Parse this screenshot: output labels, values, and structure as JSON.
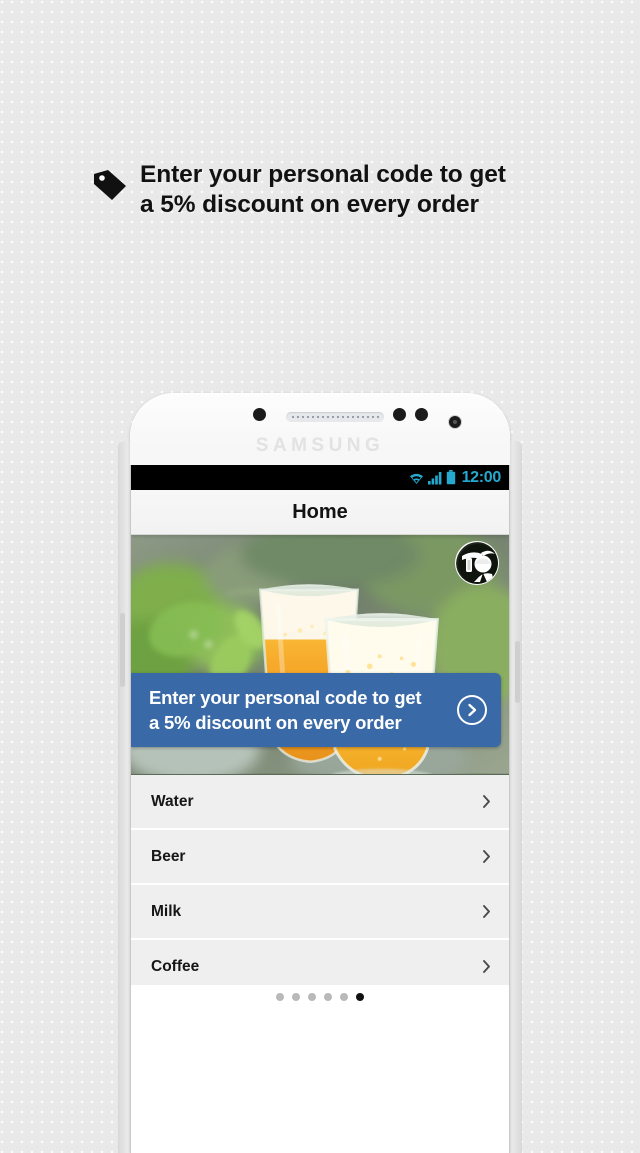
{
  "promo": {
    "icon": "price-tag-icon",
    "text": "Enter your personal code to get\na 5% discount on every order"
  },
  "device": {
    "brand": "SAMSUNG",
    "hardware": {
      "sensor": "proximity-sensor",
      "speaker": "earpiece-speaker",
      "camera": "front-camera",
      "volume_button": "volume-rocker",
      "power_button": "power-button"
    }
  },
  "statusbar": {
    "time": "12:00",
    "icons": [
      "wifi-icon",
      "cellular-signal-icon",
      "battery-icon"
    ],
    "accent_color": "#25a9cf",
    "background_color": "#000000"
  },
  "app": {
    "header": {
      "title": "Home"
    },
    "hero": {
      "image_description": "two-glasses-of-beer",
      "avatar": "profile-avatar-icon",
      "banner": {
        "text": "Enter your personal code to get\na 5% discount on every order",
        "arrow_icon": "chevron-right-circle-icon",
        "background_color": "#3a69a8",
        "text_color": "#ffffff"
      }
    },
    "list": {
      "items": [
        {
          "label": "Water",
          "chevron": "chevron-right-icon"
        },
        {
          "label": "Beer",
          "chevron": "chevron-right-icon"
        },
        {
          "label": "Milk",
          "chevron": "chevron-right-icon"
        },
        {
          "label": "Coffee",
          "chevron": "chevron-right-icon"
        }
      ]
    },
    "pager": {
      "total": 6,
      "active_index": 5,
      "inactive_color": "#b9b9b9",
      "active_color": "#111111"
    }
  }
}
